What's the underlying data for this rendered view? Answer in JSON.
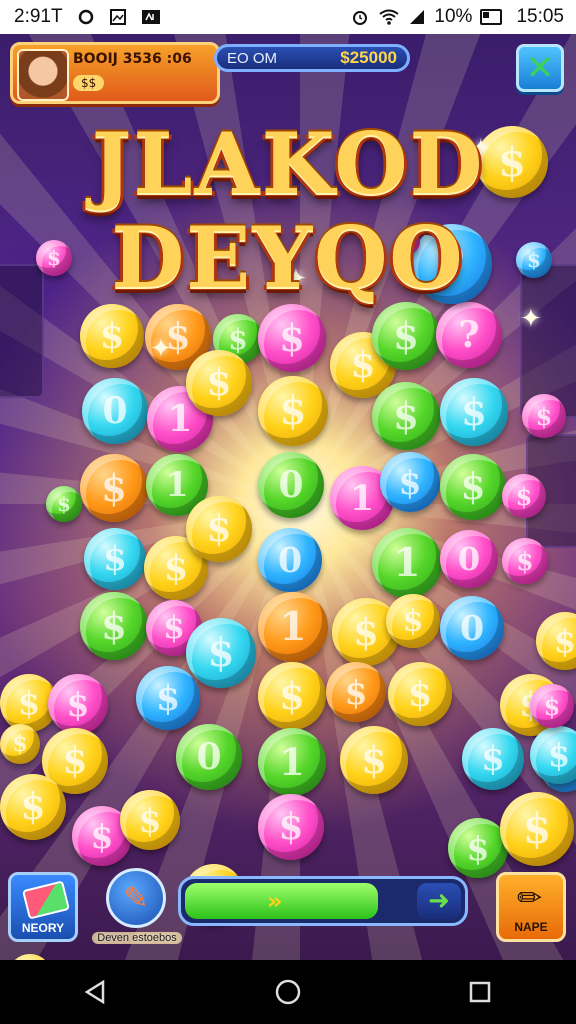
{
  "status_bar": {
    "time_left": "2:91T",
    "time_right": "15:05",
    "battery": "10%",
    "icons_left": [
      "sync-icon",
      "photo-icon",
      "app-icon"
    ],
    "icons_right": [
      "alarm-icon",
      "wifi-icon",
      "signal-icon",
      "battery-icon"
    ]
  },
  "hud": {
    "player_name": "BOOIJ 3536 :06",
    "player_sub": "$$",
    "bar_label": "EO OM",
    "bar_value": "$25000",
    "close_icon": "close-x-icon"
  },
  "title": {
    "line1": "JLAKOD",
    "line2": "DEYQO"
  },
  "colors": {
    "accent_gold": "#ffd35a",
    "title_shadow": "#b0360e",
    "progress_fill": "#2dc21a",
    "close_button": "#1a7fd6",
    "right_button": "#e86a0a"
  },
  "controls": {
    "left_button_label": "NEORY",
    "pen_label": "Deven estoebos",
    "right_button_label": "NAPE",
    "progress_value": 0.83,
    "progress_icons": [
      "double-chevron-right-icon",
      "arrow-right-icon"
    ]
  },
  "coins": [
    {
      "c": "gold",
      "g": "$"
    },
    {
      "c": "orange",
      "g": "$"
    },
    {
      "c": "green",
      "g": "$"
    },
    {
      "c": "pink",
      "g": "$"
    },
    {
      "c": "gold",
      "g": "$"
    },
    {
      "c": "green",
      "g": "$"
    },
    {
      "c": "pink",
      "g": "?"
    },
    {
      "c": "cyan",
      "g": "0"
    },
    {
      "c": "pink",
      "g": "1"
    },
    {
      "c": "gold",
      "g": "$"
    },
    {
      "c": "gold",
      "g": "$"
    },
    {
      "c": "green",
      "g": "$"
    },
    {
      "c": "cyan",
      "g": "$"
    },
    {
      "c": "pink",
      "g": "$"
    },
    {
      "c": "orange",
      "g": "$"
    },
    {
      "c": "green",
      "g": "1"
    },
    {
      "c": "green",
      "g": "0"
    },
    {
      "c": "pink",
      "g": "1"
    },
    {
      "c": "blue",
      "g": "$"
    },
    {
      "c": "green",
      "g": "$"
    },
    {
      "c": "pink",
      "g": "$"
    },
    {
      "c": "cyan",
      "g": "$"
    },
    {
      "c": "gold",
      "g": "$"
    },
    {
      "c": "gold",
      "g": "$"
    },
    {
      "c": "blue",
      "g": "0"
    },
    {
      "c": "green",
      "g": "1"
    },
    {
      "c": "pink",
      "g": "0"
    },
    {
      "c": "pink",
      "g": "$"
    },
    {
      "c": "green",
      "g": "$"
    },
    {
      "c": "pink",
      "g": "$"
    },
    {
      "c": "cyan",
      "g": "$"
    },
    {
      "c": "orange",
      "g": "1"
    },
    {
      "c": "gold",
      "g": "$"
    },
    {
      "c": "gold",
      "g": "$"
    },
    {
      "c": "blue",
      "g": "0"
    },
    {
      "c": "gold",
      "g": "$"
    },
    {
      "c": "gold",
      "g": "$"
    },
    {
      "c": "pink",
      "g": "$"
    },
    {
      "c": "blue",
      "g": "$"
    },
    {
      "c": "gold",
      "g": "$"
    },
    {
      "c": "orange",
      "g": "$"
    },
    {
      "c": "gold",
      "g": "$"
    },
    {
      "c": "gold",
      "g": "$"
    },
    {
      "c": "blue",
      "g": "$"
    },
    {
      "c": "gold",
      "g": "$"
    },
    {
      "c": "gold",
      "g": "$"
    },
    {
      "c": "green",
      "g": "0"
    },
    {
      "c": "green",
      "g": "1"
    },
    {
      "c": "gold",
      "g": "$"
    },
    {
      "c": "cyan",
      "g": "$"
    },
    {
      "c": "cyan",
      "g": "$"
    },
    {
      "c": "pink",
      "g": "$"
    },
    {
      "c": "gold",
      "g": "$"
    },
    {
      "c": "pink",
      "g": "$"
    },
    {
      "c": "gold",
      "g": "$"
    },
    {
      "c": "pink",
      "g": "$"
    },
    {
      "c": "green",
      "g": "$"
    },
    {
      "c": "gold",
      "g": "$"
    },
    {
      "c": "blue",
      "g": "?"
    },
    {
      "c": "gold",
      "g": "$"
    },
    {
      "c": "pink",
      "g": "$"
    },
    {
      "c": "blue",
      "g": "$"
    },
    {
      "c": "gold",
      "g": "$"
    },
    {
      "c": "pink",
      "g": "$"
    },
    {
      "c": "green",
      "g": "$"
    },
    {
      "c": "gold",
      "g": "$"
    }
  ]
}
